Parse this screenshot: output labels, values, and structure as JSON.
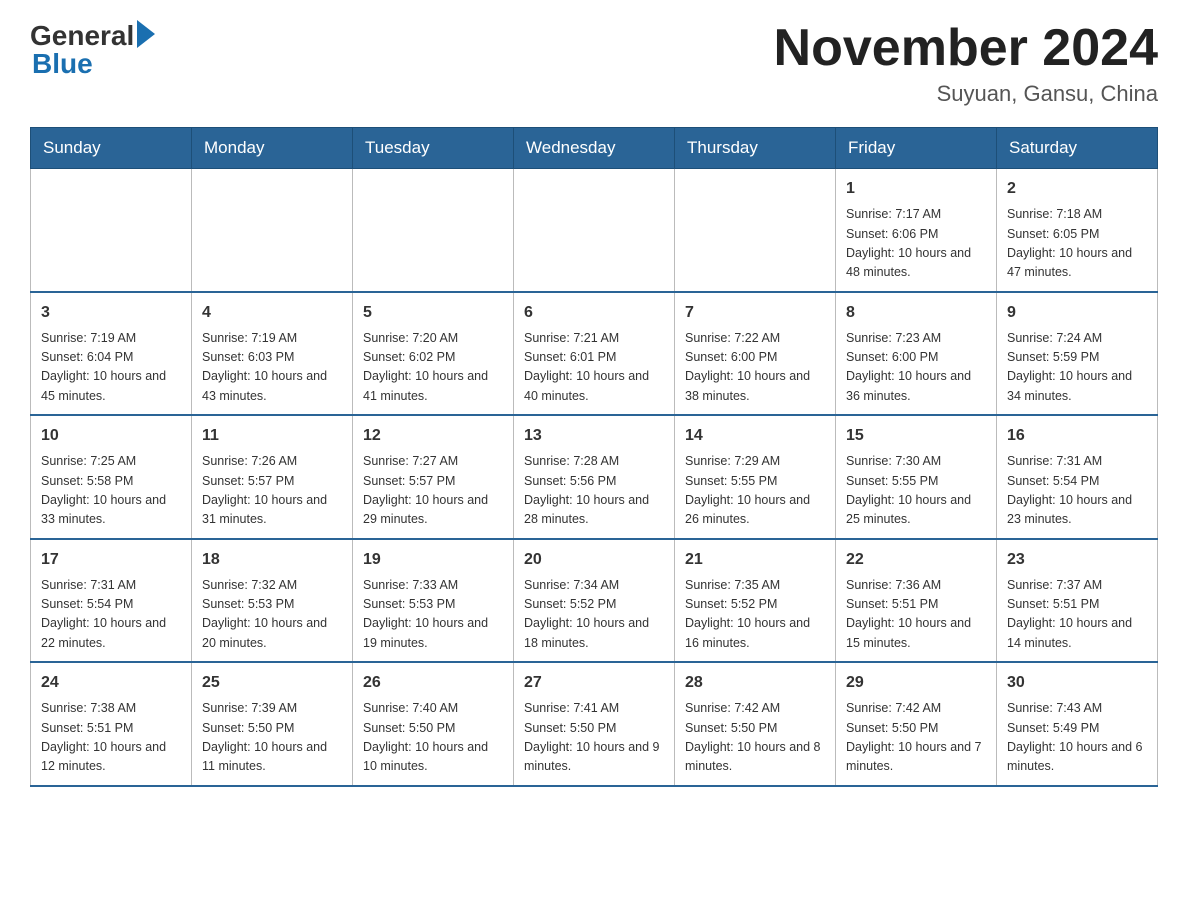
{
  "header": {
    "logo_general": "General",
    "logo_blue": "Blue",
    "month_title": "November 2024",
    "location": "Suyuan, Gansu, China"
  },
  "weekdays": [
    "Sunday",
    "Monday",
    "Tuesday",
    "Wednesday",
    "Thursday",
    "Friday",
    "Saturday"
  ],
  "weeks": [
    [
      {
        "day": "",
        "info": ""
      },
      {
        "day": "",
        "info": ""
      },
      {
        "day": "",
        "info": ""
      },
      {
        "day": "",
        "info": ""
      },
      {
        "day": "",
        "info": ""
      },
      {
        "day": "1",
        "info": "Sunrise: 7:17 AM\nSunset: 6:06 PM\nDaylight: 10 hours and 48 minutes."
      },
      {
        "day": "2",
        "info": "Sunrise: 7:18 AM\nSunset: 6:05 PM\nDaylight: 10 hours and 47 minutes."
      }
    ],
    [
      {
        "day": "3",
        "info": "Sunrise: 7:19 AM\nSunset: 6:04 PM\nDaylight: 10 hours and 45 minutes."
      },
      {
        "day": "4",
        "info": "Sunrise: 7:19 AM\nSunset: 6:03 PM\nDaylight: 10 hours and 43 minutes."
      },
      {
        "day": "5",
        "info": "Sunrise: 7:20 AM\nSunset: 6:02 PM\nDaylight: 10 hours and 41 minutes."
      },
      {
        "day": "6",
        "info": "Sunrise: 7:21 AM\nSunset: 6:01 PM\nDaylight: 10 hours and 40 minutes."
      },
      {
        "day": "7",
        "info": "Sunrise: 7:22 AM\nSunset: 6:00 PM\nDaylight: 10 hours and 38 minutes."
      },
      {
        "day": "8",
        "info": "Sunrise: 7:23 AM\nSunset: 6:00 PM\nDaylight: 10 hours and 36 minutes."
      },
      {
        "day": "9",
        "info": "Sunrise: 7:24 AM\nSunset: 5:59 PM\nDaylight: 10 hours and 34 minutes."
      }
    ],
    [
      {
        "day": "10",
        "info": "Sunrise: 7:25 AM\nSunset: 5:58 PM\nDaylight: 10 hours and 33 minutes."
      },
      {
        "day": "11",
        "info": "Sunrise: 7:26 AM\nSunset: 5:57 PM\nDaylight: 10 hours and 31 minutes."
      },
      {
        "day": "12",
        "info": "Sunrise: 7:27 AM\nSunset: 5:57 PM\nDaylight: 10 hours and 29 minutes."
      },
      {
        "day": "13",
        "info": "Sunrise: 7:28 AM\nSunset: 5:56 PM\nDaylight: 10 hours and 28 minutes."
      },
      {
        "day": "14",
        "info": "Sunrise: 7:29 AM\nSunset: 5:55 PM\nDaylight: 10 hours and 26 minutes."
      },
      {
        "day": "15",
        "info": "Sunrise: 7:30 AM\nSunset: 5:55 PM\nDaylight: 10 hours and 25 minutes."
      },
      {
        "day": "16",
        "info": "Sunrise: 7:31 AM\nSunset: 5:54 PM\nDaylight: 10 hours and 23 minutes."
      }
    ],
    [
      {
        "day": "17",
        "info": "Sunrise: 7:31 AM\nSunset: 5:54 PM\nDaylight: 10 hours and 22 minutes."
      },
      {
        "day": "18",
        "info": "Sunrise: 7:32 AM\nSunset: 5:53 PM\nDaylight: 10 hours and 20 minutes."
      },
      {
        "day": "19",
        "info": "Sunrise: 7:33 AM\nSunset: 5:53 PM\nDaylight: 10 hours and 19 minutes."
      },
      {
        "day": "20",
        "info": "Sunrise: 7:34 AM\nSunset: 5:52 PM\nDaylight: 10 hours and 18 minutes."
      },
      {
        "day": "21",
        "info": "Sunrise: 7:35 AM\nSunset: 5:52 PM\nDaylight: 10 hours and 16 minutes."
      },
      {
        "day": "22",
        "info": "Sunrise: 7:36 AM\nSunset: 5:51 PM\nDaylight: 10 hours and 15 minutes."
      },
      {
        "day": "23",
        "info": "Sunrise: 7:37 AM\nSunset: 5:51 PM\nDaylight: 10 hours and 14 minutes."
      }
    ],
    [
      {
        "day": "24",
        "info": "Sunrise: 7:38 AM\nSunset: 5:51 PM\nDaylight: 10 hours and 12 minutes."
      },
      {
        "day": "25",
        "info": "Sunrise: 7:39 AM\nSunset: 5:50 PM\nDaylight: 10 hours and 11 minutes."
      },
      {
        "day": "26",
        "info": "Sunrise: 7:40 AM\nSunset: 5:50 PM\nDaylight: 10 hours and 10 minutes."
      },
      {
        "day": "27",
        "info": "Sunrise: 7:41 AM\nSunset: 5:50 PM\nDaylight: 10 hours and 9 minutes."
      },
      {
        "day": "28",
        "info": "Sunrise: 7:42 AM\nSunset: 5:50 PM\nDaylight: 10 hours and 8 minutes."
      },
      {
        "day": "29",
        "info": "Sunrise: 7:42 AM\nSunset: 5:50 PM\nDaylight: 10 hours and 7 minutes."
      },
      {
        "day": "30",
        "info": "Sunrise: 7:43 AM\nSunset: 5:49 PM\nDaylight: 10 hours and 6 minutes."
      }
    ]
  ]
}
